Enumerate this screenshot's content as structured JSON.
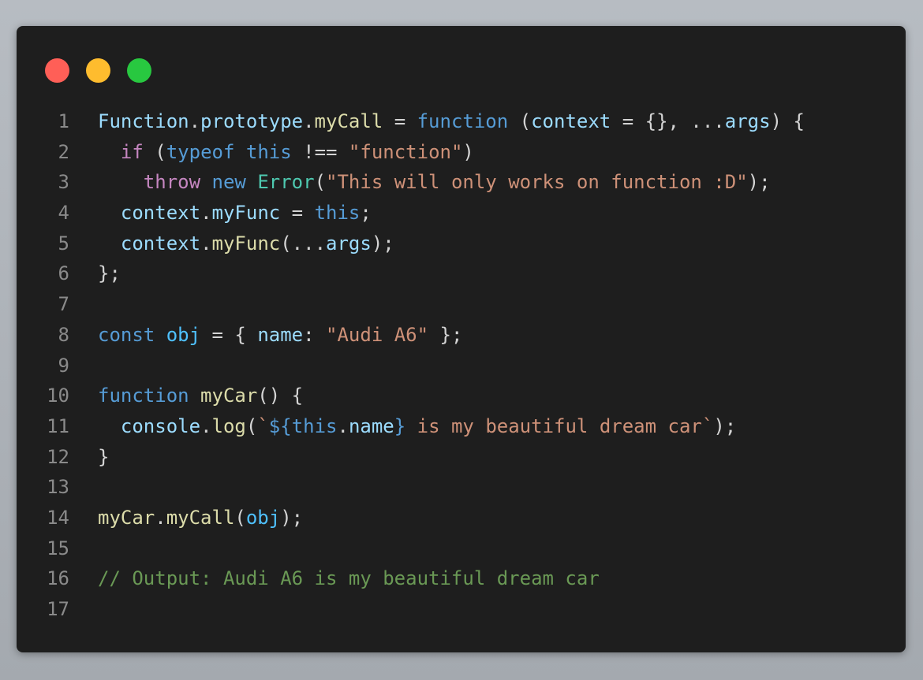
{
  "window_controls": {
    "close_color": "#ff5f57",
    "minimize_color": "#febc2e",
    "maximize_color": "#28c840"
  },
  "colors": {
    "background": "#1e1e1e",
    "default_text": "#d4d4d4",
    "keyword_blue": "#569cd6",
    "keyword_control": "#c586c0",
    "identifier": "#9cdcfe",
    "function_name": "#dcdcaa",
    "class_name": "#4ec9b0",
    "string": "#ce9178",
    "comment": "#6a9955",
    "line_number": "#8a8a8a"
  },
  "code_lines": [
    {
      "n": "1",
      "tokens": [
        {
          "t": "Function",
          "c": "#9cdcfe"
        },
        {
          "t": ".",
          "c": "#d4d4d4"
        },
        {
          "t": "prototype",
          "c": "#9cdcfe"
        },
        {
          "t": ".",
          "c": "#d4d4d4"
        },
        {
          "t": "myCall",
          "c": "#dcdcaa"
        },
        {
          "t": " = ",
          "c": "#d4d4d4"
        },
        {
          "t": "function",
          "c": "#569cd6"
        },
        {
          "t": " (",
          "c": "#d4d4d4"
        },
        {
          "t": "context",
          "c": "#9cdcfe"
        },
        {
          "t": " = {}, ...",
          "c": "#d4d4d4"
        },
        {
          "t": "args",
          "c": "#9cdcfe"
        },
        {
          "t": ") {",
          "c": "#d4d4d4"
        }
      ]
    },
    {
      "n": "2",
      "tokens": [
        {
          "t": "  ",
          "c": "#d4d4d4"
        },
        {
          "t": "if",
          "c": "#c586c0"
        },
        {
          "t": " (",
          "c": "#d4d4d4"
        },
        {
          "t": "typeof",
          "c": "#569cd6"
        },
        {
          "t": " ",
          "c": "#d4d4d4"
        },
        {
          "t": "this",
          "c": "#569cd6"
        },
        {
          "t": " !== ",
          "c": "#d4d4d4"
        },
        {
          "t": "\"function\"",
          "c": "#ce9178"
        },
        {
          "t": ")",
          "c": "#d4d4d4"
        }
      ]
    },
    {
      "n": "3",
      "tokens": [
        {
          "t": "    ",
          "c": "#d4d4d4"
        },
        {
          "t": "throw",
          "c": "#c586c0"
        },
        {
          "t": " ",
          "c": "#d4d4d4"
        },
        {
          "t": "new",
          "c": "#569cd6"
        },
        {
          "t": " ",
          "c": "#d4d4d4"
        },
        {
          "t": "Error",
          "c": "#4ec9b0"
        },
        {
          "t": "(",
          "c": "#d4d4d4"
        },
        {
          "t": "\"This will only works on function :D\"",
          "c": "#ce9178"
        },
        {
          "t": ");",
          "c": "#d4d4d4"
        }
      ]
    },
    {
      "n": "4",
      "tokens": [
        {
          "t": "  ",
          "c": "#d4d4d4"
        },
        {
          "t": "context",
          "c": "#9cdcfe"
        },
        {
          "t": ".",
          "c": "#d4d4d4"
        },
        {
          "t": "myFunc",
          "c": "#9cdcfe"
        },
        {
          "t": " = ",
          "c": "#d4d4d4"
        },
        {
          "t": "this",
          "c": "#569cd6"
        },
        {
          "t": ";",
          "c": "#d4d4d4"
        }
      ]
    },
    {
      "n": "5",
      "tokens": [
        {
          "t": "  ",
          "c": "#d4d4d4"
        },
        {
          "t": "context",
          "c": "#9cdcfe"
        },
        {
          "t": ".",
          "c": "#d4d4d4"
        },
        {
          "t": "myFunc",
          "c": "#dcdcaa"
        },
        {
          "t": "(...",
          "c": "#d4d4d4"
        },
        {
          "t": "args",
          "c": "#9cdcfe"
        },
        {
          "t": ");",
          "c": "#d4d4d4"
        }
      ]
    },
    {
      "n": "6",
      "tokens": [
        {
          "t": "};",
          "c": "#d4d4d4"
        }
      ]
    },
    {
      "n": "7",
      "tokens": []
    },
    {
      "n": "8",
      "tokens": [
        {
          "t": "const",
          "c": "#569cd6"
        },
        {
          "t": " ",
          "c": "#d4d4d4"
        },
        {
          "t": "obj",
          "c": "#4fc1ff"
        },
        {
          "t": " = { ",
          "c": "#d4d4d4"
        },
        {
          "t": "name",
          "c": "#9cdcfe"
        },
        {
          "t": ": ",
          "c": "#d4d4d4"
        },
        {
          "t": "\"Audi A6\"",
          "c": "#ce9178"
        },
        {
          "t": " };",
          "c": "#d4d4d4"
        }
      ]
    },
    {
      "n": "9",
      "tokens": []
    },
    {
      "n": "10",
      "tokens": [
        {
          "t": "function",
          "c": "#569cd6"
        },
        {
          "t": " ",
          "c": "#d4d4d4"
        },
        {
          "t": "myCar",
          "c": "#dcdcaa"
        },
        {
          "t": "() {",
          "c": "#d4d4d4"
        }
      ]
    },
    {
      "n": "11",
      "tokens": [
        {
          "t": "  ",
          "c": "#d4d4d4"
        },
        {
          "t": "console",
          "c": "#9cdcfe"
        },
        {
          "t": ".",
          "c": "#d4d4d4"
        },
        {
          "t": "log",
          "c": "#dcdcaa"
        },
        {
          "t": "(",
          "c": "#d4d4d4"
        },
        {
          "t": "`",
          "c": "#ce9178"
        },
        {
          "t": "${",
          "c": "#569cd6"
        },
        {
          "t": "this",
          "c": "#569cd6"
        },
        {
          "t": ".",
          "c": "#d4d4d4"
        },
        {
          "t": "name",
          "c": "#9cdcfe"
        },
        {
          "t": "}",
          "c": "#569cd6"
        },
        {
          "t": " is my beautiful dream car`",
          "c": "#ce9178"
        },
        {
          "t": ");",
          "c": "#d4d4d4"
        }
      ]
    },
    {
      "n": "12",
      "tokens": [
        {
          "t": "}",
          "c": "#d4d4d4"
        }
      ]
    },
    {
      "n": "13",
      "tokens": []
    },
    {
      "n": "14",
      "tokens": [
        {
          "t": "myCar",
          "c": "#dcdcaa"
        },
        {
          "t": ".",
          "c": "#d4d4d4"
        },
        {
          "t": "myCall",
          "c": "#dcdcaa"
        },
        {
          "t": "(",
          "c": "#d4d4d4"
        },
        {
          "t": "obj",
          "c": "#4fc1ff"
        },
        {
          "t": ");",
          "c": "#d4d4d4"
        }
      ]
    },
    {
      "n": "15",
      "tokens": []
    },
    {
      "n": "16",
      "tokens": [
        {
          "t": "// Output: Audi A6 is my beautiful dream car",
          "c": "#6a9955"
        }
      ]
    },
    {
      "n": "17",
      "tokens": []
    }
  ]
}
